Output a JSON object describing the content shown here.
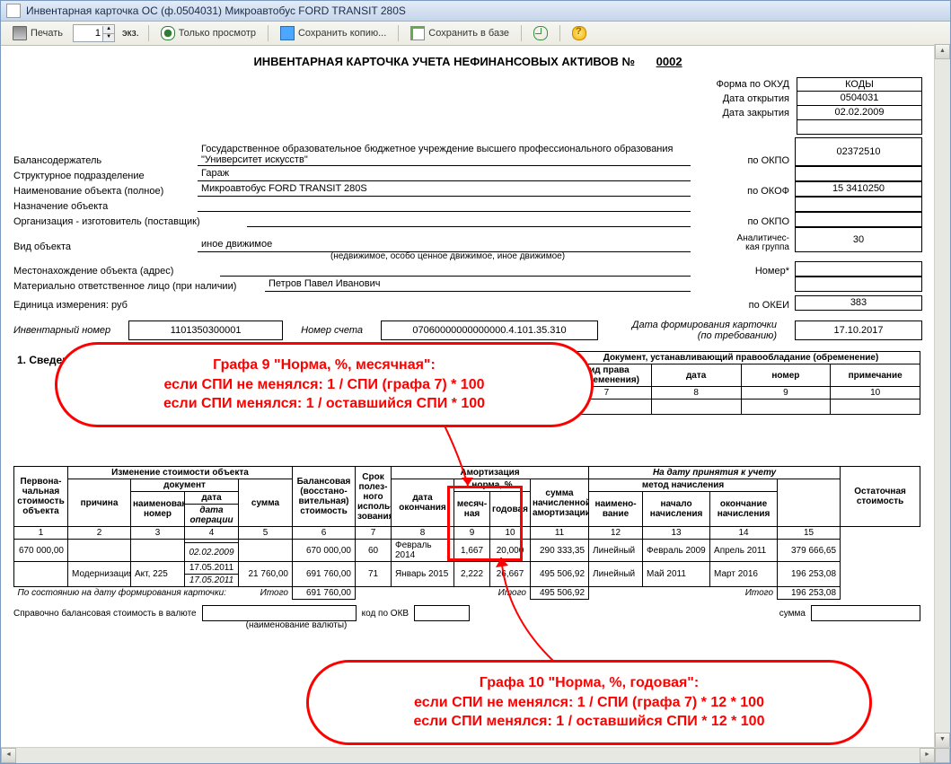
{
  "window_title": "Инвентарная карточка ОС (ф.0504031) Микроавтобус FORD TRANSIT 280S",
  "toolbar": {
    "print": "Печать",
    "copies": "1",
    "copies_unit": "экз.",
    "view_only": "Только просмотр",
    "save_copy": "Сохранить копию...",
    "save_base": "Сохранить в базе"
  },
  "doc": {
    "title": "ИНВЕНТАРНАЯ КАРТОЧКА УЧЕТА НЕФИНАНСОВЫХ АКТИВОВ    №",
    "number": "0002",
    "codes_header": "КОДЫ",
    "form_okud_label": "Форма по ОКУД",
    "form_okud": "0504031",
    "open_date_label": "Дата открытия",
    "open_date": "02.02.2009",
    "close_date_label": "Дата закрытия",
    "close_date": "",
    "holder_label": "Балансодержатель",
    "holder_value": "Государственное образовательное бюджетное учреждение высшего профессионального образования \"Университет искусств\"",
    "okpo_label": "по ОКПО",
    "okpo1": "02372510",
    "dept_label": "Структурное подразделение",
    "dept_value": "Гараж",
    "name_label": "Наименование объекта (полное)",
    "name_value": "Микроавтобус FORD TRANSIT 280S",
    "okof_label": "по ОКОФ",
    "okof": "15 3410250",
    "purpose_label": "Назначение объекта",
    "maker_label": "Организация - изготовитель (поставщик)",
    "okpo2_label": "по ОКПО",
    "okpo2": "",
    "kind_label": "Вид объекта",
    "kind_value": "иное движимое",
    "kind_note": "(недвижимое, особо ценное движимое, иное движимое)",
    "analytic_label": "Аналитичес-\nкая группа",
    "analytic": "30",
    "location_label": "Местонахождение объекта (адрес)",
    "nomer_label": "Номер*",
    "nomer": "",
    "resp_label": "Материально ответственное лицо (при наличии)",
    "resp_value": "Петров Павел Иванович",
    "unit_label": "Единица измерения: руб",
    "okei_label": "по ОКЕИ",
    "okei": "383",
    "inv_num_label": "Инвентарный номер",
    "inv_num": "1101350300001",
    "acct_label": "Номер счета",
    "acct": "07060000000000000.4.101.35.310",
    "card_date_label": "Дата формирования карточки (по требованию)",
    "card_date": "17.10.2017",
    "section1": "1. Сведения об объекте"
  },
  "rights_table": {
    "caption": "Документ, устанавливающий правообладание (обременение)",
    "h1": "вид права (обременения)",
    "h2": "дата",
    "h3": "номер",
    "h4": "примечание",
    "c1": "7",
    "c2": "8",
    "c3": "9",
    "c4": "10"
  },
  "main_table": {
    "h_first": "Первона-чальная стоимость объекта",
    "h_change": "Изменение стоимости объекта",
    "h_reason": "причина",
    "h_doc": "документ",
    "h_doc_name": "наименование, номер",
    "h_doc_date": "дата",
    "h_doc_date2": "дата операции",
    "h_sum": "сумма",
    "h_balance": "Балансовая (восстано-вительная) стоимость",
    "h_useful": "Срок полез-ного исполь-зования",
    "h_amort": "Амортизация",
    "h_accept": "На дату принятия к учету",
    "h_enddate": "дата окончания",
    "h_norm": "норма, %",
    "h_month": "месяч-ная",
    "h_year": "годовая",
    "h_accrued": "сумма начисленной амортизации",
    "h_method": "метод начисления",
    "h_method_name": "наимено-вание",
    "h_method_start": "начало начисления",
    "h_method_end": "окончание начисления",
    "h_residual": "Остаточная стоимость",
    "cols": [
      "1",
      "2",
      "3",
      "4",
      "5",
      "6",
      "7",
      "8",
      "9",
      "10",
      "11",
      "12",
      "13",
      "14",
      "15"
    ],
    "rows": [
      {
        "c1": "670 000,00",
        "c2": "",
        "c3": "",
        "c4a": "",
        "c4b": "02.02.2009",
        "c5": "",
        "c6": "670 000,00",
        "c7": "60",
        "c8": "Февраль 2014",
        "c9": "1,667",
        "c10": "20,000",
        "c11": "290 333,35",
        "c12": "Линейный",
        "c13": "Февраль 2009",
        "c14": "Апрель 2011",
        "c15": "379 666,65"
      },
      {
        "c1": "",
        "c2": "Модернизация",
        "c3": "Акт, 225",
        "c4a": "17.05.2011",
        "c4b": "17.05.2011",
        "c5": "21 760,00",
        "c6": "691 760,00",
        "c7": "71",
        "c8": "Январь 2015",
        "c9": "2,222",
        "c10": "26,667",
        "c11": "495 506,92",
        "c12": "Линейный",
        "c13": "Май 2011",
        "c14": "Март 2016",
        "c15": "196 253,08"
      }
    ],
    "totals_label": "По состоянию на дату формирования карточки:",
    "itogo": "Итого",
    "t6": "691 760,00",
    "t11": "495 506,92",
    "t15": "196 253,08"
  },
  "okv": {
    "label": "Справочно балансовая стоимость в валюте",
    "note": "(наименование валюты)",
    "code_label": "код по ОКВ",
    "sum_label": "сумма"
  },
  "callouts": {
    "c1_l1": "Графа 9 \"Норма, %, месячная\":",
    "c1_l2": "если СПИ не менялся: 1 / СПИ (графа 7) * 100",
    "c1_l3": "если СПИ менялся: 1 / оставшийся СПИ * 100",
    "c2_l1": "Графа 10 \"Норма, %, годовая\":",
    "c2_l2": "если СПИ не менялся: 1 / СПИ (графа 7) * 12 * 100",
    "c2_l3": "если СПИ менялся: 1 / оставшийся СПИ * 12 * 100"
  }
}
